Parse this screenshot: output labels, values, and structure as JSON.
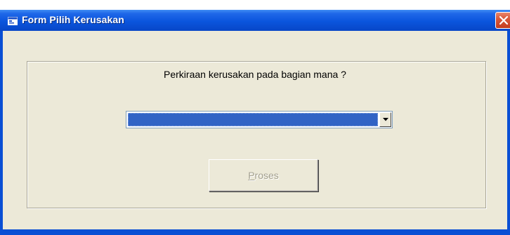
{
  "window": {
    "title": "Form Pilih Kerusakan",
    "title_icon": "form-window-icon",
    "close_icon": "close-icon"
  },
  "form": {
    "question": "Perkiraan kerusakan pada bagian mana ?",
    "combo": {
      "selected_value": "",
      "arrow_icon": "chevron-down-icon"
    },
    "proses_button": {
      "label_accel": "P",
      "label_rest": "roses",
      "enabled": false
    }
  },
  "colors": {
    "titlebar": "#0a55dd",
    "client_bg": "#ece9d8",
    "selection": "#3163c5",
    "close_button": "#d9583a",
    "disabled_text": "#a3a08f"
  }
}
